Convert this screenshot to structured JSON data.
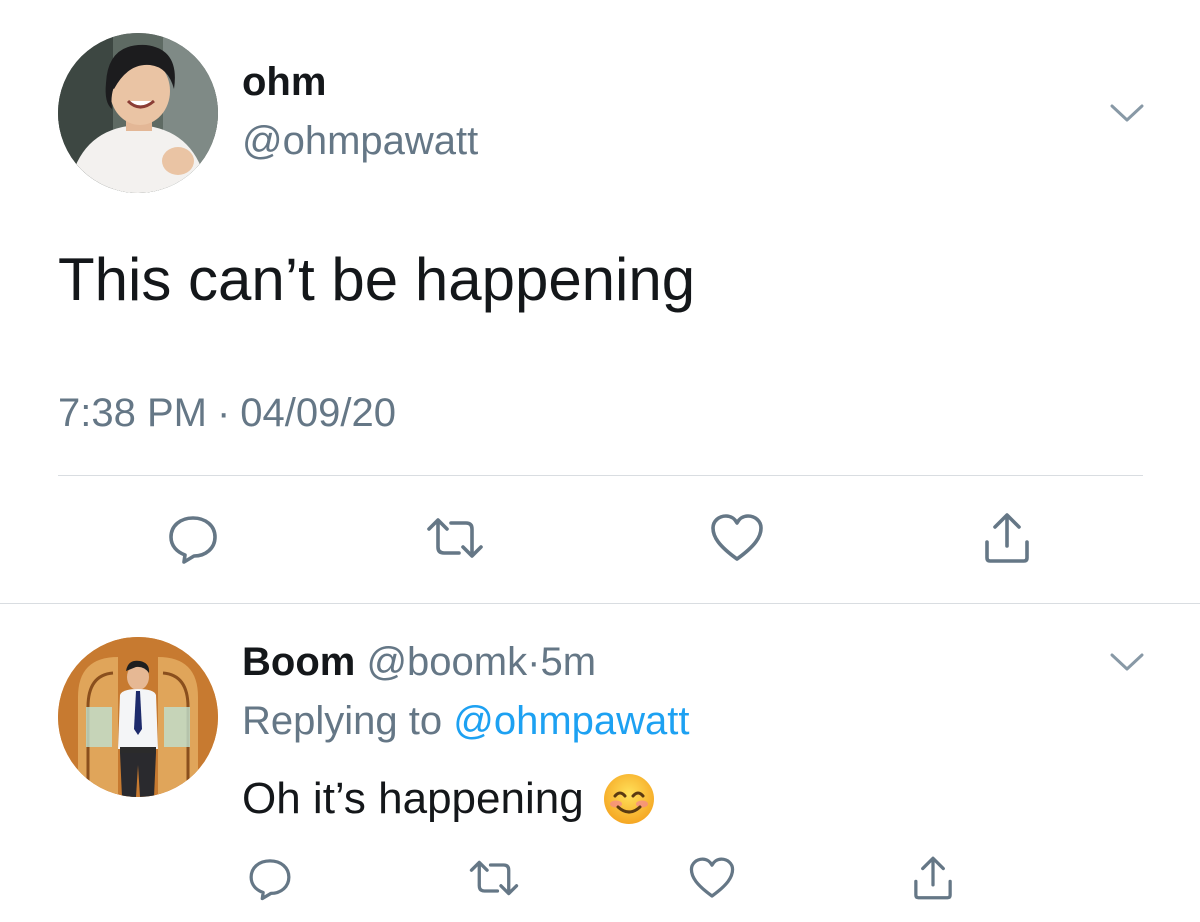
{
  "main_tweet": {
    "display_name": "ohm",
    "handle": "@ohmpawatt",
    "text": "This can’t be happening",
    "time": "7:38 PM",
    "separator": "·",
    "date": "04/09/20",
    "icons": {
      "menu": "chevron-down-icon",
      "reply": "reply-icon",
      "retweet": "retweet-icon",
      "like": "heart-icon",
      "share": "share-icon"
    }
  },
  "reply_tweet": {
    "display_name": "Boom",
    "handle": "@boomk",
    "separator": "·",
    "time_ago": "5m",
    "replying_to_label": "Replying to",
    "replying_to_handle": "@ohmpawatt",
    "text": "Oh it’s happening",
    "emoji": "smiling-face-icon",
    "icons": {
      "menu": "chevron-down-icon",
      "reply": "reply-icon",
      "retweet": "retweet-icon",
      "like": "heart-icon",
      "share": "share-icon"
    }
  },
  "colors": {
    "text_primary": "#14171a",
    "text_secondary": "#657786",
    "link": "#1da1f2",
    "icon": "#657786",
    "divider": "#d9dde1",
    "background": "#ffffff"
  }
}
